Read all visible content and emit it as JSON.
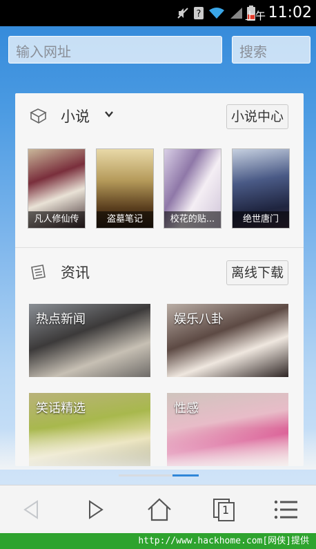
{
  "status_bar": {
    "ampm": "上午",
    "time": "11:02"
  },
  "address_bar": {
    "url_placeholder": "输入网址",
    "search_label": "搜索"
  },
  "novels": {
    "title": "小说",
    "center_button": "小说中心",
    "books": [
      {
        "title": "凡人修仙传"
      },
      {
        "title": "盗墓笔记"
      },
      {
        "title": "校花的贴..."
      },
      {
        "title": "绝世唐门"
      }
    ]
  },
  "news": {
    "title": "资讯",
    "offline_button": "离线下载",
    "tiles": [
      {
        "label": "热点新闻"
      },
      {
        "label": "娱乐八卦"
      },
      {
        "label": "笑话精选"
      },
      {
        "label": "性感"
      }
    ]
  },
  "toolbar": {
    "tab_count": "1"
  },
  "footer": {
    "credit": "http://www.hackhome.com[网侠]提供"
  },
  "colors": {
    "accent": "#2f86d8",
    "frame_green": "#2ea32e",
    "pager_active": "#2f86d8"
  }
}
